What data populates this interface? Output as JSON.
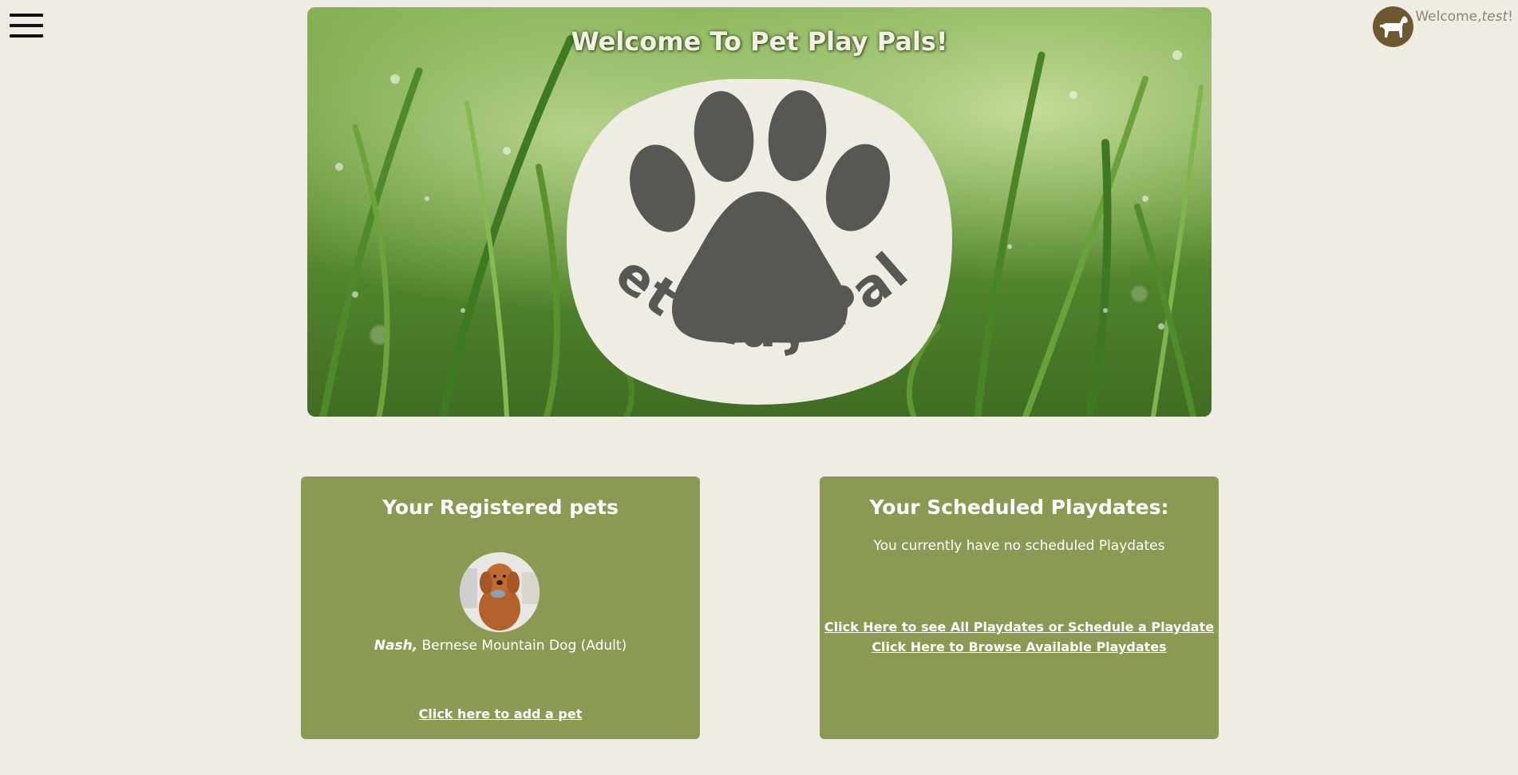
{
  "header": {
    "menu_icon": "hamburger-menu-icon",
    "welcome_prefix": "Welcome,",
    "username": "test",
    "welcome_suffix": "!",
    "avatar_icon": "dog-silhouette-icon",
    "avatar_color": "#6e5830"
  },
  "hero": {
    "title": "Welcome To Pet Play Pals!",
    "logo_text": "Pet Play Pals",
    "logo_icon": "paw-print-icon",
    "logo_bg": "#efece3",
    "logo_fg": "#575753"
  },
  "pets_card": {
    "title": "Your Registered pets",
    "pets": [
      {
        "name": "Nash,",
        "breed": "Bernese Mountain Dog (Adult)",
        "photo_icon": "dog-photo"
      }
    ],
    "add_link": "Click here to add a pet"
  },
  "playdates_card": {
    "title": "Your Scheduled Playdates:",
    "empty_message": "You currently have no scheduled Playdates",
    "links": [
      "Click Here to see All Playdates or Schedule a Playdate",
      "Click Here to Browse Available Playdates"
    ]
  },
  "colors": {
    "page_bg": "#efece3",
    "card_bg": "#8a9a52",
    "card_text": "#ffffff"
  }
}
